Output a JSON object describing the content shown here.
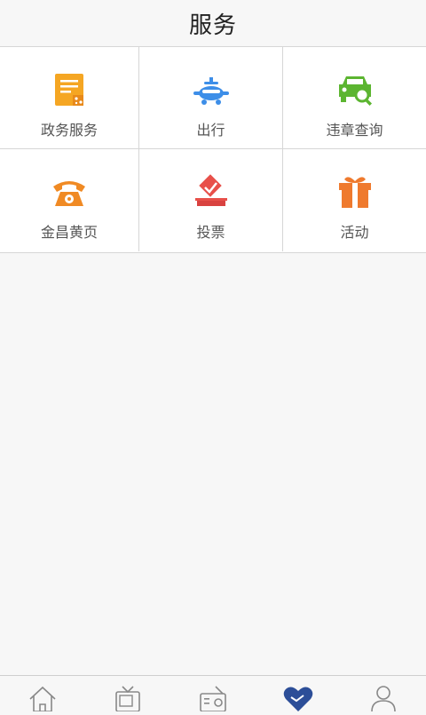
{
  "header": {
    "title": "服务"
  },
  "services": [
    {
      "label": "政务服务",
      "icon": "gov-document-icon",
      "color": "#f5a623"
    },
    {
      "label": "出行",
      "icon": "airplane-icon",
      "color": "#3d8ee8"
    },
    {
      "label": "违章查询",
      "icon": "car-search-icon",
      "color": "#5cb531"
    },
    {
      "label": "金昌黄页",
      "icon": "telephone-icon",
      "color": "#f08a24"
    },
    {
      "label": "投票",
      "icon": "ballot-box-icon",
      "color": "#e8504a"
    },
    {
      "label": "活动",
      "icon": "gift-icon",
      "color": "#ef7a2e"
    }
  ],
  "tabbar": {
    "active_color": "#2c4e98",
    "inactive_color": "#888888",
    "items": [
      {
        "icon": "home-icon",
        "active": false
      },
      {
        "icon": "tv-icon",
        "active": false
      },
      {
        "icon": "radio-icon",
        "active": false
      },
      {
        "icon": "heart-hands-icon",
        "active": true
      },
      {
        "icon": "person-icon",
        "active": false
      }
    ]
  }
}
